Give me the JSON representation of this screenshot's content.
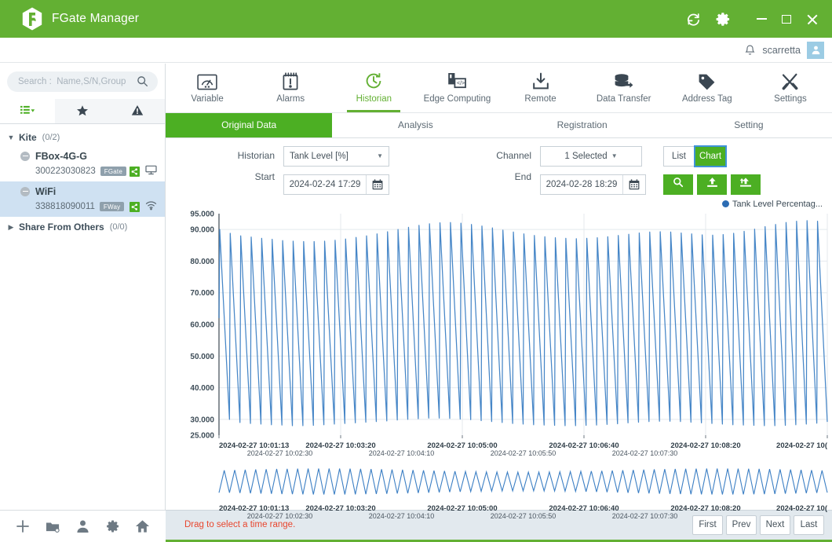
{
  "titlebar": {
    "app_title": "FGate Manager",
    "logo_icon": "fgate-hex-logo",
    "refresh_icon": "refresh-icon",
    "settings_icon": "gear-icon",
    "minimize_label": "minimize-icon",
    "maximize_label": "maximize-icon",
    "close_label": "close-icon",
    "brand_color": "#63b033"
  },
  "userbar": {
    "bell_icon": "bell-icon",
    "username": "scarretta",
    "avatar_icon": "user-avatar-icon",
    "avatar_color": "#9ccce4"
  },
  "sidebar": {
    "search": {
      "placeholder": "Search :  Name,S/N,Group",
      "value": "",
      "icon": "search-icon"
    },
    "filters": [
      {
        "name": "list-filter",
        "icon": "list-dropdown-icon",
        "active": true
      },
      {
        "name": "favorites-filter",
        "icon": "star-icon",
        "active": false
      },
      {
        "name": "alarms-filter",
        "icon": "warning-triangle-icon",
        "active": false
      }
    ],
    "groups": [
      {
        "name": "Kite",
        "count": "(0/2)",
        "expanded": true,
        "devices": [
          {
            "name": "FBox-4G-G",
            "serial": "300223030823",
            "badge": "FGate",
            "selected": false,
            "status_icon": "share-icon",
            "type_icon": "monitor-icon"
          },
          {
            "name": "WiFi",
            "serial": "338818090011",
            "badge": "FWay",
            "selected": true,
            "status_icon": "share-icon",
            "type_icon": "wifi-icon"
          }
        ]
      },
      {
        "name": "Share From Others",
        "count": "(0/0)",
        "expanded": false,
        "devices": []
      }
    ],
    "bottom_tools": [
      {
        "name": "add-button",
        "icon": "plus-icon"
      },
      {
        "name": "new-folder-button",
        "icon": "folder-icon"
      },
      {
        "name": "user-button",
        "icon": "person-icon"
      },
      {
        "name": "settings-button",
        "icon": "gear-icon"
      },
      {
        "name": "home-button",
        "icon": "home-icon"
      }
    ]
  },
  "nav": {
    "items": [
      {
        "label": "Variable",
        "icon": "gauge-icon",
        "active": false
      },
      {
        "label": "Alarms",
        "icon": "alarm-clipboard-icon",
        "active": false
      },
      {
        "label": "Historian",
        "icon": "history-clock-icon",
        "active": true
      },
      {
        "label": "Edge Computing",
        "icon": "edge-code-icon",
        "active": false
      },
      {
        "label": "Remote",
        "icon": "download-tray-icon",
        "active": false
      },
      {
        "label": "Data Transfer",
        "icon": "database-arrow-icon",
        "active": false
      },
      {
        "label": "Address Tag",
        "icon": "tag-icon",
        "active": false
      },
      {
        "label": "Settings",
        "icon": "tools-icon",
        "active": false
      }
    ]
  },
  "tabs": [
    {
      "label": "Original Data",
      "active": true
    },
    {
      "label": "Analysis",
      "active": false
    },
    {
      "label": "Registration",
      "active": false
    },
    {
      "label": "Setting",
      "active": false
    }
  ],
  "form": {
    "historian_label": "Historian",
    "historian_value": "Tank Level [%]",
    "start_label": "Start",
    "start_value": "2024-02-24 17:29",
    "channel_label": "Channel",
    "channel_value": "1 Selected",
    "end_label": "End",
    "end_value": "2024-02-28 18:29",
    "calendar_icon": "calendar-icon",
    "view_list_label": "List",
    "view_chart_label": "Chart",
    "view_active": "Chart",
    "search_button_icon": "magnifier-icon",
    "export_button_icon": "export-icon",
    "export_all_button_icon": "export-all-icon"
  },
  "chart_data": {
    "type": "line",
    "title": "",
    "xlabel": "",
    "ylabel": "",
    "legend": [
      {
        "name": "Tank Level Percentag...",
        "color": "#2c6cb3"
      }
    ],
    "legend_position": "top-right",
    "grid": true,
    "ylim": [
      25.0,
      95.0
    ],
    "ytick_labels": [
      "95.000",
      "90.000",
      "80.000",
      "70.000",
      "60.000",
      "50.000",
      "40.000",
      "30.000",
      "25.000"
    ],
    "yticks": [
      95.0,
      90.0,
      80.0,
      70.0,
      60.0,
      50.0,
      40.0,
      30.0,
      25.0
    ],
    "xtick_labels_top": [
      "2024-02-27 10:01:13",
      "2024-02-27 10:03:20",
      "2024-02-27 10:05:00",
      "2024-02-27 10:06:40",
      "2024-02-27 10:08:20",
      "2024-02-27 10("
    ],
    "xtick_labels_bottom": [
      "2024-02-27 10:02:30",
      "2024-02-27 10:04:10",
      "2024-02-27 10:05:50",
      "2024-02-27 10:07:30"
    ],
    "x_start": "2024-02-27 10:01:13",
    "x_end": "2024-02-27 10:09:00",
    "series": [
      {
        "name": "Tank Level Percentage",
        "color": "#3c7fc4",
        "waveform": "sawtooth",
        "cycles": 58,
        "trough_values": [
          30.0,
          29.0,
          28.7,
          28.5,
          28.3,
          28.2,
          28.0,
          28.0,
          28.1,
          28.3,
          28.5,
          28.7,
          28.9,
          29.1,
          29.3,
          29.5,
          29.8,
          30.0,
          30.2,
          30.4,
          30.4,
          30.3,
          30.1,
          29.9,
          29.6,
          29.3,
          29.0,
          28.7,
          28.5,
          28.3,
          28.2,
          28.1,
          28.0,
          28.0,
          28.1,
          28.2,
          28.4,
          28.6,
          28.9,
          29.1,
          29.3,
          29.4,
          29.4,
          29.3,
          29.1,
          28.9,
          28.7,
          28.5,
          28.3,
          28.2,
          28.1,
          28.0,
          28.0,
          28.1,
          28.3,
          28.5,
          28.8,
          29.2
        ],
        "peak_values": [
          90.0,
          88.8,
          88.0,
          87.6,
          87.2,
          86.9,
          86.5,
          86.3,
          86.2,
          86.2,
          86.3,
          86.6,
          87.0,
          87.5,
          88.0,
          88.6,
          89.3,
          90.0,
          90.7,
          91.3,
          91.8,
          92.1,
          92.2,
          92.0,
          91.6,
          91.1,
          90.5,
          89.8,
          89.2,
          88.6,
          88.1,
          87.7,
          87.4,
          87.2,
          87.1,
          87.2,
          87.4,
          87.7,
          88.1,
          88.5,
          88.9,
          89.2,
          89.3,
          89.2,
          88.9,
          88.6,
          88.3,
          88.2,
          88.4,
          88.8,
          89.4,
          90.1,
          90.9,
          91.6,
          92.2,
          92.6,
          92.8,
          92.6
        ]
      }
    ],
    "overview": {
      "type": "line",
      "name": "range-selector-overview",
      "color": "#3c7fc4",
      "xtick_labels_top": [
        "2024-02-27 10:01:13",
        "2024-02-27 10:03:20",
        "2024-02-27 10:05:00",
        "2024-02-27 10:06:40",
        "2024-02-27 10:08:20",
        "2024-02-27 10("
      ],
      "xtick_labels_bottom": [
        "2024-02-27 10:02:30",
        "2024-02-27 10:04:10",
        "2024-02-27 10:05:50",
        "2024-02-27 10:07:30"
      ]
    }
  },
  "statusbar": {
    "message": "Drag to select a time range.",
    "message_color": "#e8462e",
    "pager": [
      "First",
      "Prev",
      "Next",
      "Last"
    ]
  }
}
